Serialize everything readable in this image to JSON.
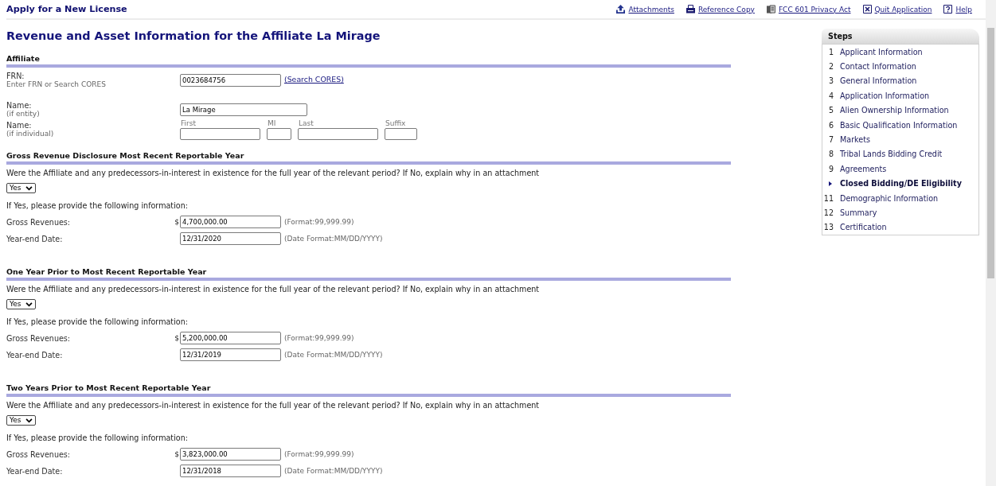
{
  "header": {
    "title": "Apply for a New License",
    "links": [
      {
        "kind": "upload",
        "label": "Attachments"
      },
      {
        "kind": "print",
        "label": "Reference Copy"
      },
      {
        "kind": "pages",
        "label": "FCC 601 Privacy Act"
      },
      {
        "kind": "quit",
        "label": "Quit Application"
      },
      {
        "kind": "help",
        "label": "Help"
      }
    ]
  },
  "page_title": "Revenue and Asset Information for the Affiliate La Mirage",
  "affiliate": {
    "heading": "Affiliate",
    "frn": {
      "label": "FRN:",
      "note": "Enter FRN or Search CORES",
      "value": "0023684756",
      "link": "(Search CORES)"
    },
    "entity_name": {
      "label": "Name:",
      "note": "(if entity)",
      "value": "La Mirage"
    },
    "individual_name": {
      "label": "Name:",
      "note": "(if individual)",
      "parts": [
        {
          "label": "First"
        },
        {
          "label": "MI"
        },
        {
          "label": "Last"
        },
        {
          "label": "Suffix"
        }
      ]
    }
  },
  "sections": [
    {
      "heading": "Gross Revenue Disclosure Most Recent Reportable Year",
      "question": "Were the Affiliate and any predecessors-in-interest in existence for the full year of the relevant period? If No, explain why in an attachment",
      "answer": "Yes",
      "prompt": "If Yes, please provide the following information:",
      "revenue": {
        "label": "Gross Revenues:",
        "currency": "$",
        "value": "4,700,000.00",
        "format": "(Format:99,999.99)"
      },
      "year_end": {
        "label": "Year-end Date:",
        "value": "12/31/2020",
        "format": "(Date Format:MM/DD/YYYY)"
      }
    },
    {
      "heading": "One Year Prior to Most Recent Reportable Year",
      "question": "Were the Affiliate and any predecessors-in-interest in existence for the full year of the relevant period? If No, explain why in an attachment",
      "answer": "Yes",
      "prompt": "If Yes, please provide the following information:",
      "revenue": {
        "label": "Gross Revenues:",
        "currency": "$",
        "value": "5,200,000.00",
        "format": "(Format:99,999.99)"
      },
      "year_end": {
        "label": "Year-end Date:",
        "value": "12/31/2019",
        "format": "(Date Format:MM/DD/YYYY)"
      }
    },
    {
      "heading": "Two Years Prior to Most Recent Reportable Year",
      "question": "Were the Affiliate and any predecessors-in-interest in existence for the full year of the relevant period? If No, explain why in an attachment",
      "answer": "Yes",
      "prompt": "If Yes, please provide the following information:",
      "revenue": {
        "label": "Gross Revenues:",
        "currency": "$",
        "value": "3,823,000.00",
        "format": "(Format:99,999.99)"
      },
      "year_end": {
        "label": "Year-end Date:",
        "value": "12/31/2018",
        "format": "(Date Format:MM/DD/YYYY)"
      }
    }
  ],
  "steps": {
    "title": "Steps",
    "items": [
      {
        "number": "1",
        "label": "Applicant Information",
        "selected": false
      },
      {
        "number": "2",
        "label": "Contact Information",
        "selected": false
      },
      {
        "number": "3",
        "label": "General Information",
        "selected": false
      },
      {
        "number": "4",
        "label": "Application Information",
        "selected": false
      },
      {
        "number": "5",
        "label": "Alien Ownership Information",
        "selected": false
      },
      {
        "number": "6",
        "label": "Basic Qualification Information",
        "selected": false
      },
      {
        "number": "7",
        "label": "Markets",
        "selected": false
      },
      {
        "number": "8",
        "label": "Tribal Lands Bidding Credit",
        "selected": false
      },
      {
        "number": "9",
        "label": "Agreements",
        "selected": false
      },
      {
        "label": "Closed Bidding/DE Eligibility",
        "selected": true
      },
      {
        "number": "11",
        "label": "Demographic Information",
        "selected": false
      },
      {
        "number": "12",
        "label": "Summary",
        "selected": false
      },
      {
        "number": "13",
        "label": "Certification",
        "selected": false
      }
    ]
  }
}
